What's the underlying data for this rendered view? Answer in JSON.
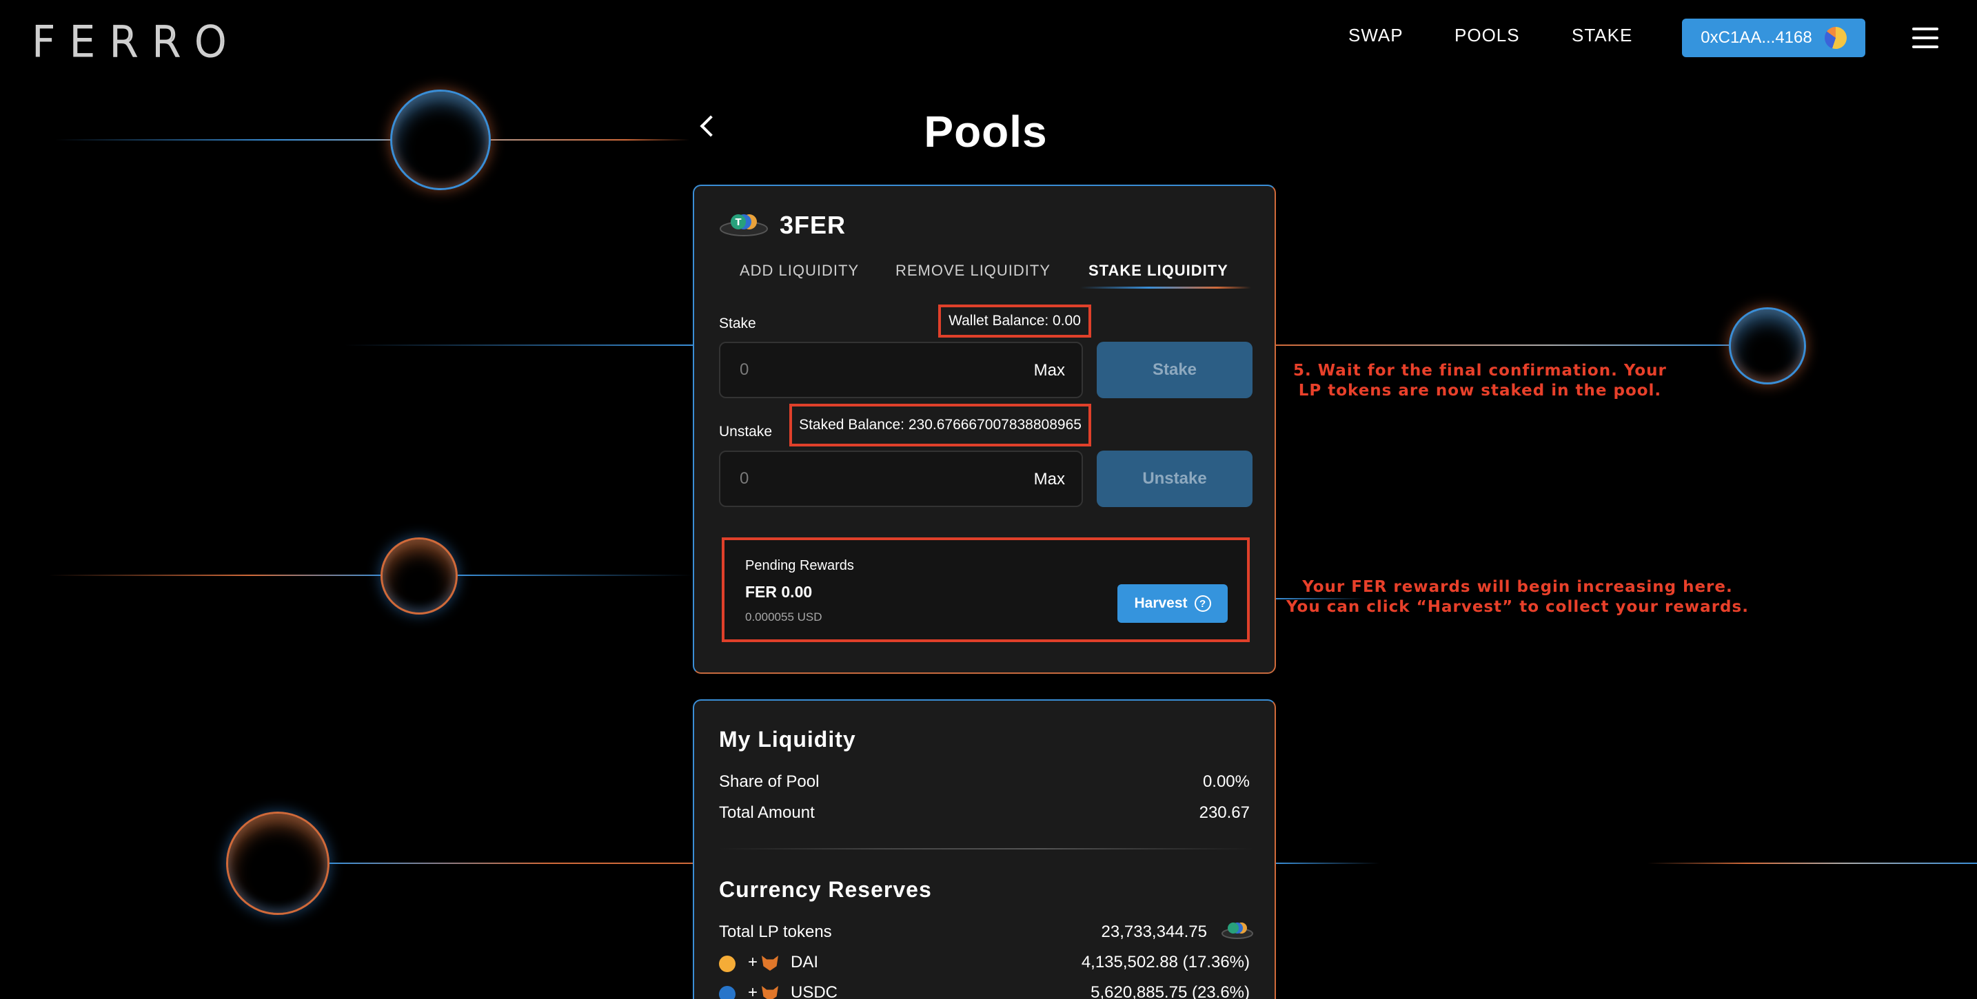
{
  "header": {
    "logo": "FERRO",
    "nav": {
      "swap": "SWAP",
      "pools": "POOLS",
      "stake": "STAKE"
    },
    "wallet_address": "0xC1AA...4168",
    "menu_icon": "hamburger-icon"
  },
  "page": {
    "title": "Pools",
    "back_icon": "chevron-left-icon"
  },
  "stake_card": {
    "pool_name": "3FER",
    "tabs": [
      "ADD LIQUIDITY",
      "REMOVE LIQUIDITY",
      "STAKE LIQUIDITY"
    ],
    "active_tab": "STAKE LIQUIDITY",
    "stake": {
      "label": "Stake",
      "balance": "Wallet Balance: 0.00",
      "placeholder": "0",
      "max": "Max",
      "button": "Stake"
    },
    "unstake": {
      "label": "Unstake",
      "balance": "Staked Balance: 230.676667007838808965",
      "placeholder": "0",
      "max": "Max",
      "button": "Unstake"
    },
    "rewards": {
      "label": "Pending Rewards",
      "value": "FER 0.00",
      "usd": "0.000055 USD",
      "button": "Harvest",
      "help_icon": "?"
    }
  },
  "liquidity_card": {
    "title": "My Liquidity",
    "rows": [
      {
        "label": "Share of Pool",
        "value": "0.00%"
      },
      {
        "label": "Total Amount",
        "value": "230.67"
      }
    ],
    "reserves_title": "Currency Reserves",
    "reserves": [
      {
        "label": "Total LP tokens",
        "value": "23,733,344.75"
      },
      {
        "label": "DAI",
        "value": "4,135,502.88 (17.36%)"
      },
      {
        "label": "USDC",
        "value": "5,620,885.75 (23.6%)"
      }
    ],
    "plus": "+"
  },
  "annotations": {
    "step5_line1": "5. Wait for the final confirmation. Your",
    "step5_line2": "LP tokens are now staked in the pool.",
    "rewards_line1": "Your FER rewards will begin increasing here.",
    "rewards_line2": "You can click “Harvest” to collect your rewards."
  },
  "colors": {
    "accent_blue": "#3594dd",
    "accent_orange": "#d06a3a",
    "highlight_red": "#e0402a",
    "disabled_button": "#2c5e85"
  }
}
